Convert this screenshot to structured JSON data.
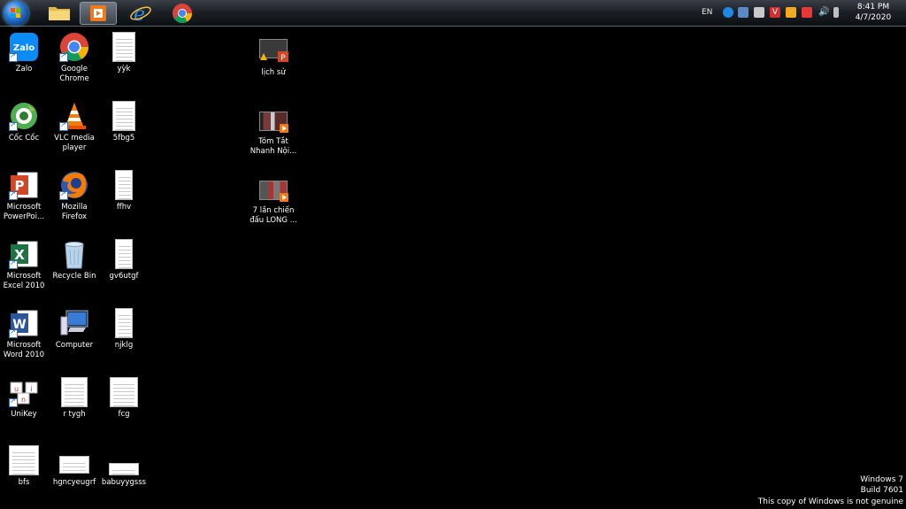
{
  "taskbar": {
    "pinned": [
      "start-orb",
      "file-explorer-icon",
      "media-player-icon",
      "internet-explorer-icon",
      "chrome-icon"
    ],
    "tray": {
      "lang": "EN",
      "time": "8:41 PM",
      "date": "4/7/2020"
    }
  },
  "desktop": {
    "icons": [
      {
        "label": "Zalo"
      },
      {
        "label": "Google Chrome"
      },
      {
        "label": "yỳk"
      },
      {
        "label": "lịch sử"
      },
      {
        "label": "Cốc Cốc"
      },
      {
        "label": "VLC media player"
      },
      {
        "label": "5fbg5"
      },
      {
        "label": "Tóm Tắt Nhanh Nội..."
      },
      {
        "label": "Microsoft PowerPoi..."
      },
      {
        "label": "Mozilla Firefox"
      },
      {
        "label": "ffhv"
      },
      {
        "label": "7 lần chiến đấu LONG ..."
      },
      {
        "label": "Microsoft Excel 2010"
      },
      {
        "label": "Recycle Bin"
      },
      {
        "label": "gv6utgf"
      },
      {
        "label": "Microsoft Word 2010"
      },
      {
        "label": "Computer"
      },
      {
        "label": "njklg"
      },
      {
        "label": "UniKey"
      },
      {
        "label": "r tygh"
      },
      {
        "label": "fcg"
      },
      {
        "label": "bfs"
      },
      {
        "label": "hgncyeugrf"
      },
      {
        "label": "babuyygsss"
      }
    ]
  },
  "watermark": {
    "line1": "Windows 7",
    "line2": "Build 7601",
    "line3": "This copy of Windows is not genuine"
  }
}
